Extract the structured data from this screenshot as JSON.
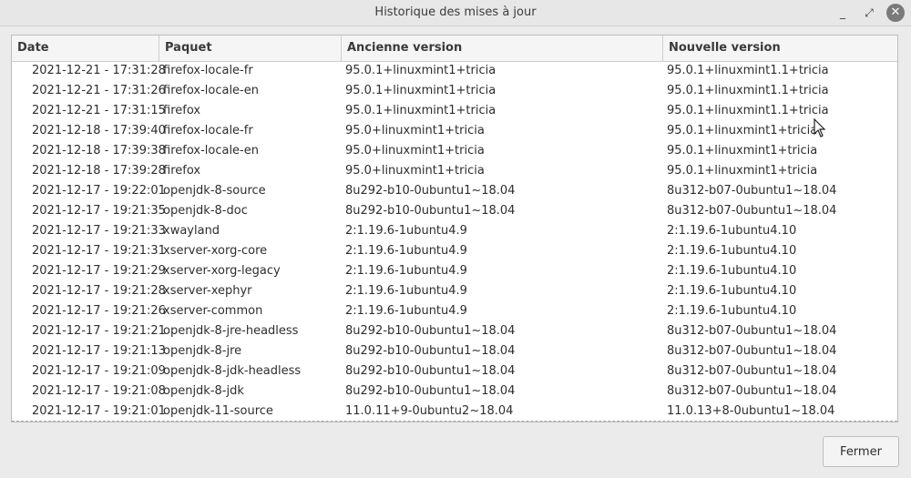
{
  "window": {
    "title": "Historique des mises à jour",
    "minimize_glyph": "_",
    "maximize_glyph": "⤢",
    "close_glyph": "✕"
  },
  "table": {
    "columns": [
      "Date",
      "Paquet",
      "Ancienne version",
      "Nouvelle version"
    ],
    "rows": [
      [
        "2021-12-21 - 17:31:28",
        "firefox-locale-fr",
        "95.0.1+linuxmint1+tricia",
        "95.0.1+linuxmint1.1+tricia"
      ],
      [
        "2021-12-21 - 17:31:26",
        "firefox-locale-en",
        "95.0.1+linuxmint1+tricia",
        "95.0.1+linuxmint1.1+tricia"
      ],
      [
        "2021-12-21 - 17:31:15",
        "firefox",
        "95.0.1+linuxmint1+tricia",
        "95.0.1+linuxmint1.1+tricia"
      ],
      [
        "2021-12-18 - 17:39:40",
        "firefox-locale-fr",
        "95.0+linuxmint1+tricia",
        "95.0.1+linuxmint1+tricia"
      ],
      [
        "2021-12-18 - 17:39:38",
        "firefox-locale-en",
        "95.0+linuxmint1+tricia",
        "95.0.1+linuxmint1+tricia"
      ],
      [
        "2021-12-18 - 17:39:28",
        "firefox",
        "95.0+linuxmint1+tricia",
        "95.0.1+linuxmint1+tricia"
      ],
      [
        "2021-12-17 - 19:22:01",
        "openjdk-8-source",
        "8u292-b10-0ubuntu1~18.04",
        "8u312-b07-0ubuntu1~18.04"
      ],
      [
        "2021-12-17 - 19:21:35",
        "openjdk-8-doc",
        "8u292-b10-0ubuntu1~18.04",
        "8u312-b07-0ubuntu1~18.04"
      ],
      [
        "2021-12-17 - 19:21:33",
        "xwayland",
        "2:1.19.6-1ubuntu4.9",
        "2:1.19.6-1ubuntu4.10"
      ],
      [
        "2021-12-17 - 19:21:31",
        "xserver-xorg-core",
        "2:1.19.6-1ubuntu4.9",
        "2:1.19.6-1ubuntu4.10"
      ],
      [
        "2021-12-17 - 19:21:29",
        "xserver-xorg-legacy",
        "2:1.19.6-1ubuntu4.9",
        "2:1.19.6-1ubuntu4.10"
      ],
      [
        "2021-12-17 - 19:21:28",
        "xserver-xephyr",
        "2:1.19.6-1ubuntu4.9",
        "2:1.19.6-1ubuntu4.10"
      ],
      [
        "2021-12-17 - 19:21:26",
        "xserver-common",
        "2:1.19.6-1ubuntu4.9",
        "2:1.19.6-1ubuntu4.10"
      ],
      [
        "2021-12-17 - 19:21:21",
        "openjdk-8-jre-headless",
        "8u292-b10-0ubuntu1~18.04",
        "8u312-b07-0ubuntu1~18.04"
      ],
      [
        "2021-12-17 - 19:21:13",
        "openjdk-8-jre",
        "8u292-b10-0ubuntu1~18.04",
        "8u312-b07-0ubuntu1~18.04"
      ],
      [
        "2021-12-17 - 19:21:09",
        "openjdk-8-jdk-headless",
        "8u292-b10-0ubuntu1~18.04",
        "8u312-b07-0ubuntu1~18.04"
      ],
      [
        "2021-12-17 - 19:21:08",
        "openjdk-8-jdk",
        "8u292-b10-0ubuntu1~18.04",
        "8u312-b07-0ubuntu1~18.04"
      ],
      [
        "2021-12-17 - 19:21:01",
        "openjdk-11-source",
        "11.0.11+9-0ubuntu2~18.04",
        "11.0.13+8-0ubuntu1~18.04"
      ]
    ]
  },
  "footer": {
    "close_label": "Fermer"
  }
}
